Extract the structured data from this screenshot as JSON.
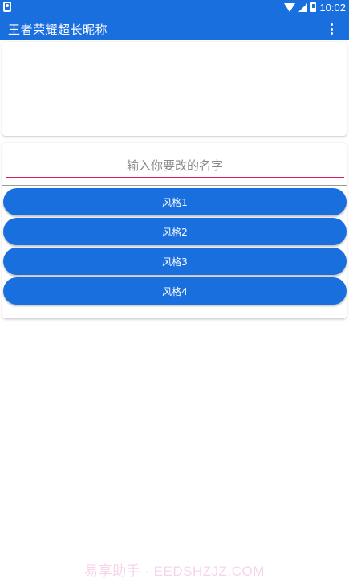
{
  "status_bar": {
    "time": "10:02",
    "icons": [
      "sim-card-icon",
      "wifi-icon",
      "signal-icon",
      "battery-icon"
    ]
  },
  "app_bar": {
    "title": "王者荣耀超长昵称",
    "menu_icon": "more-vert-icon"
  },
  "input": {
    "value": "",
    "placeholder": "输入你要改的名字"
  },
  "buttons": [
    {
      "label": "风格1"
    },
    {
      "label": "风格2"
    },
    {
      "label": "风格3"
    },
    {
      "label": "风格4"
    }
  ],
  "watermark": "易享助手 · EEDSHZJZ.COM",
  "colors": {
    "primary": "#1a6fde",
    "input_underline": "#d81b60",
    "background": "#ffffff"
  }
}
